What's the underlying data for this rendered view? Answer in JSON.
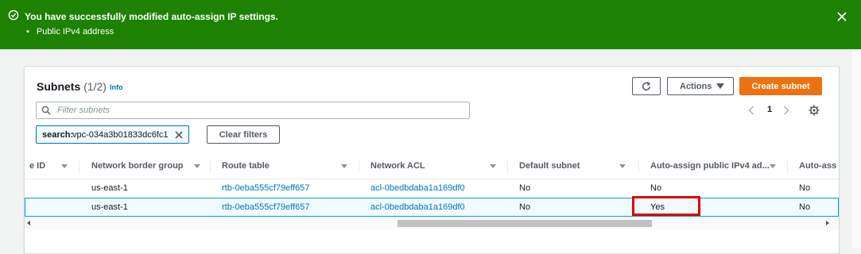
{
  "flash": {
    "title": "You have successfully modified auto-assign IP settings.",
    "items": [
      "Public IPv4 address"
    ],
    "bg_color": "#1d8102",
    "icons": {
      "status": "check-circle-icon",
      "close": "close-icon"
    }
  },
  "panel": {
    "title": "Subnets",
    "count": "(1/2)",
    "info_link": "Info",
    "refresh_icon": "refresh-icon",
    "actions_label": "Actions",
    "create_label": "Create subnet",
    "search_placeholder": "Filter subnets",
    "filter_token": {
      "key": "search:",
      "value": "vpc-034a3b01833dc6fc1"
    },
    "clear_filters_label": "Clear filters",
    "page_number": "1",
    "accent_color": "#ec7211"
  },
  "table": {
    "columns": [
      {
        "label": "e ID"
      },
      {
        "label": "Network border group"
      },
      {
        "label": "Route table"
      },
      {
        "label": "Network ACL"
      },
      {
        "label": "Default subnet"
      },
      {
        "label": "Auto-assign public IPv4 ad..."
      },
      {
        "label": "Auto-ass"
      }
    ],
    "rows": [
      {
        "border_group": "us-east-1",
        "route_table": "rtb-0eba555cf79eff657",
        "network_acl": "acl-0bedbdaba1a169df0",
        "default_subnet": "No",
        "auto_ipv4": "No",
        "auto_other": "No"
      },
      {
        "border_group": "us-east-1",
        "route_table": "rtb-0eba555cf79eff657",
        "network_acl": "acl-0bedbdaba1a169df0",
        "default_subnet": "No",
        "auto_ipv4": "Yes",
        "auto_other": "No",
        "selected": true
      }
    ]
  }
}
